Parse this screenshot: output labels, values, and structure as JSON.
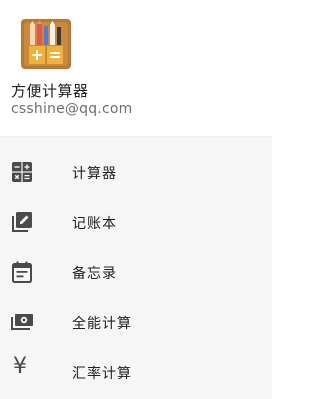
{
  "header": {
    "app_name": "方便计算器",
    "email": "csshine@qq.com"
  },
  "menu": {
    "items": [
      {
        "label": "计算器",
        "icon": "calculator-icon"
      },
      {
        "label": "记账本",
        "icon": "edit-note-icon"
      },
      {
        "label": "备忘录",
        "icon": "calendar-note-icon"
      },
      {
        "label": "全能计算",
        "icon": "money-icon"
      },
      {
        "label": "汇率计算",
        "icon": "yen-icon"
      }
    ]
  },
  "colors": {
    "menu_background": "#f6f6f6",
    "icon_color": "#4a4a4a",
    "app_icon_background": "#b77a33"
  },
  "icon_glyphs": {
    "yen": "¥"
  }
}
